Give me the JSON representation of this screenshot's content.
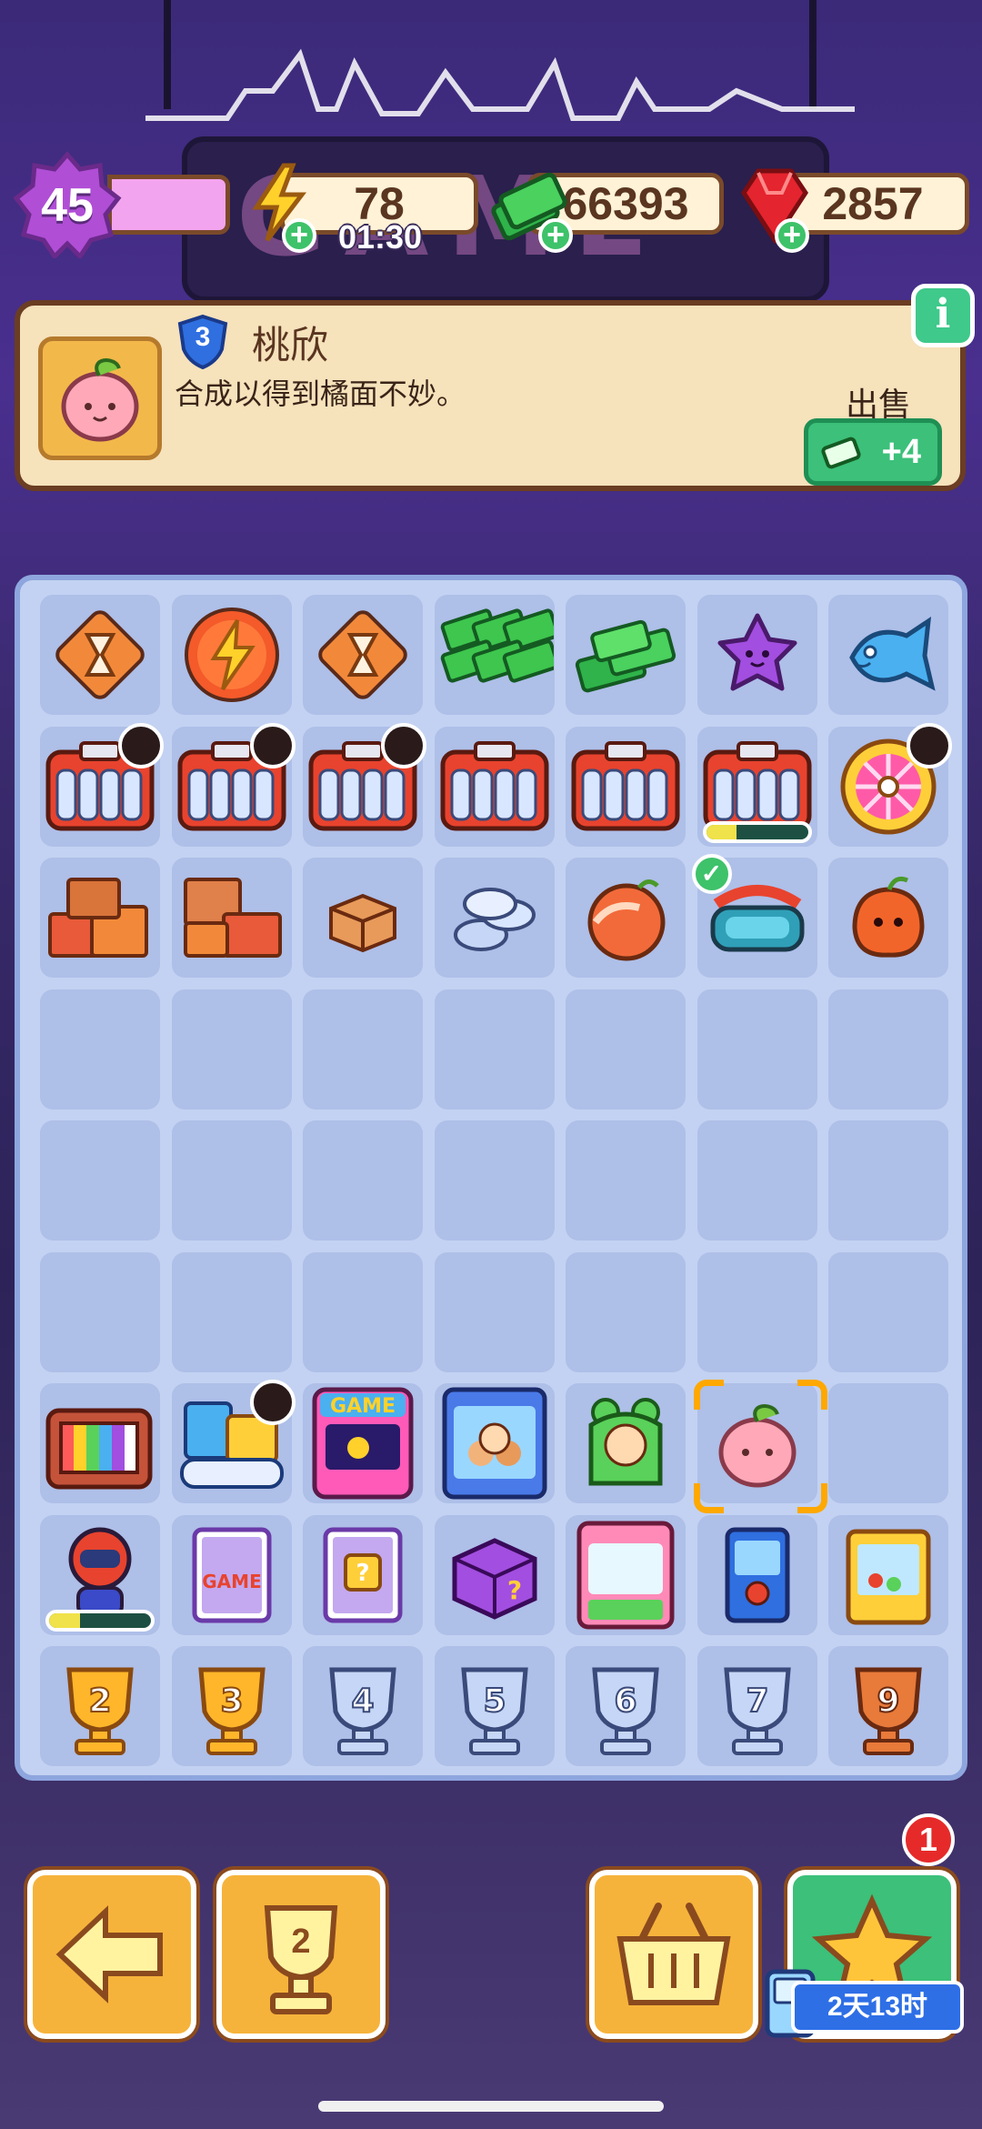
{
  "hud": {
    "level": "45",
    "energy": "78",
    "energy_timer": "01:30",
    "cash": "66393",
    "gems": "2857"
  },
  "info": {
    "item_level": "3",
    "name": "桃欣",
    "description": "合成以得到橘面不妙。",
    "info_label": "i",
    "sell_label": "出售",
    "sell_value": "+4"
  },
  "board": {
    "rows": [
      [
        "hourglass-token-icon",
        "energy-orb-icon",
        "hourglass-token-icon",
        "cash-pile-large-icon",
        "cash-stack-icon",
        "purple-star-blob-icon",
        "blue-fish-icon"
      ],
      [
        "coin-tray-icon",
        "coin-tray-icon",
        "coin-tray-icon",
        "coin-tray-icon",
        "coin-tray-icon",
        "open-coin-tray-icon",
        "prize-wheel-icon"
      ],
      [
        "box-pile-icon",
        "box-stack-icon",
        "small-box-icon",
        "silver-coins-icon",
        "peach-seed-icon",
        "vr-headset-icon",
        "orange-fruit-icon"
      ],
      [
        "",
        "",
        "",
        "",
        "",
        "",
        ""
      ],
      [
        "",
        "",
        "",
        "",
        "",
        "",
        ""
      ],
      [
        "",
        "",
        "",
        "",
        "",
        "",
        ""
      ],
      [
        "retro-tv-icon",
        "game-console-bundle-icon",
        "arcade-machine-icon",
        "claw-machine-icon",
        "frog-costume-kid-icon",
        "peach-icon",
        ""
      ],
      [
        "racer-robot-icon",
        "game-card-icon",
        "mystery-card-icon",
        "purple-mystery-box-icon",
        "claw-crane-icon",
        "mini-arcade-icon",
        "prize-crane-icon"
      ],
      [
        "trophy-2-icon",
        "trophy-3-icon",
        "trophy-4-icon",
        "trophy-5-icon",
        "trophy-6-icon",
        "trophy-7-icon",
        "trophy-9-icon"
      ]
    ],
    "trophy_numbers": [
      "2",
      "3",
      "4",
      "5",
      "6",
      "7",
      "9"
    ],
    "progress_tray": 0.3,
    "progress_racer": 0.3
  },
  "bottom": {
    "trophy_level": "2",
    "notification_count": "1",
    "event_timer": "2天13时"
  },
  "colors": {
    "accent_orange": "#f6b33b",
    "accent_green": "#3cc07a",
    "board_bg": "#c3d2f2",
    "cell_bg": "#aebfe8"
  }
}
